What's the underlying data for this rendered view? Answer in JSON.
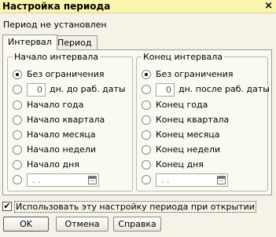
{
  "window": {
    "title": "Настройка периода",
    "close_glyph": "×"
  },
  "status_text": "Период не установлен",
  "tabs": [
    {
      "label": "Интервал",
      "active": true
    },
    {
      "label": "Период",
      "active": false
    }
  ],
  "start_group": {
    "title": "Начало интервала",
    "options": [
      {
        "label": "Без ограничения",
        "selected": true
      },
      {
        "value": "0",
        "label": "дн. до раб. даты",
        "selected": false
      },
      {
        "label": "Начало года",
        "selected": false
      },
      {
        "label": "Начало квартала",
        "selected": false
      },
      {
        "label": "Начало месяца",
        "selected": false
      },
      {
        "label": "Начало недели",
        "selected": false
      },
      {
        "label": "Начало дня",
        "selected": false
      },
      {
        "value": " .  .",
        "selected": false,
        "icon": "calendar-icon"
      }
    ]
  },
  "end_group": {
    "title": "Конец интервала",
    "options": [
      {
        "label": "Без ограничения",
        "selected": true
      },
      {
        "value": "0",
        "label": "дн. после раб. даты",
        "selected": false
      },
      {
        "label": "Конец года",
        "selected": false
      },
      {
        "label": "Конец квартала",
        "selected": false
      },
      {
        "label": "Конец месяца",
        "selected": false
      },
      {
        "label": "Конец недели",
        "selected": false
      },
      {
        "label": "Конец дня",
        "selected": false
      },
      {
        "value": " .  .",
        "selected": false,
        "icon": "calendar-icon"
      }
    ]
  },
  "use_setting": {
    "checked": true,
    "check_glyph": "✔",
    "label": "Использовать эту настройку периода при открытии"
  },
  "buttons": {
    "ok": "OK",
    "cancel": "Отмена",
    "help": "Справка"
  },
  "colors": {
    "titlebar": "#fbf6ae",
    "window_bg": "#f5f3e8"
  }
}
